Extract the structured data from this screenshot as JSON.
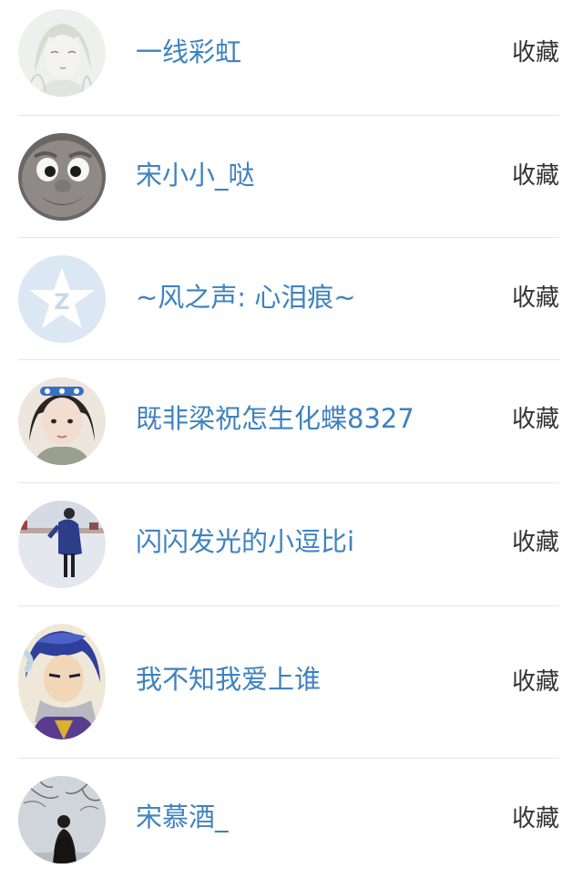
{
  "items": [
    {
      "name": "一线彩虹",
      "action": "收藏",
      "avatar": "anime-girl-sketch-avatar"
    },
    {
      "name": "宋小小_哒",
      "action": "收藏",
      "avatar": "cartoon-face-avatar"
    },
    {
      "name": "~风之声: 心泪痕~",
      "action": "收藏",
      "avatar": "qq-default-avatar"
    },
    {
      "name": "既非梁祝怎生化蝶8327",
      "action": "收藏",
      "avatar": "girl-with-headband-avatar"
    },
    {
      "name": "闪闪发光的小逗比i",
      "action": "收藏",
      "avatar": "person-in-snow-avatar"
    },
    {
      "name": "我不知我爱上谁",
      "action": "收藏",
      "avatar": "anime-boy-avatar"
    },
    {
      "name": "宋慕酒_",
      "action": "收藏",
      "avatar": "person-under-tree-avatar"
    }
  ],
  "colors": {
    "name": "#3e82c0",
    "action": "#333333",
    "divider": "#e6e6e6"
  }
}
